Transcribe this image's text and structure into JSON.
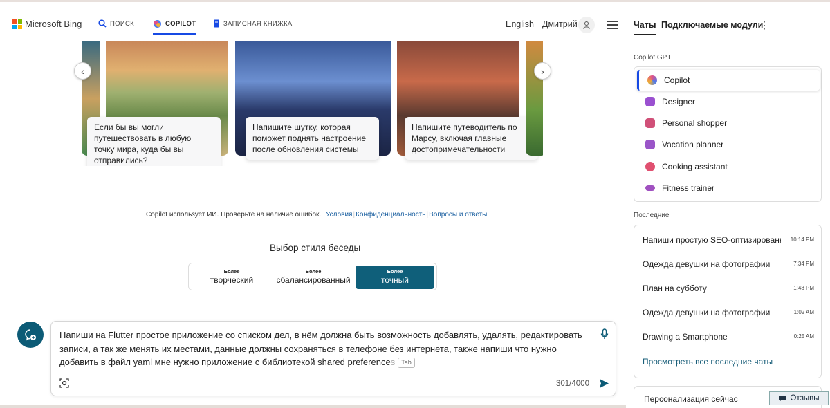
{
  "brand": "Microsoft Bing",
  "nav": {
    "search": "ПОИСК",
    "copilot": "COPILOT",
    "notebook": "ЗАПИСНАЯ КНИЖКА",
    "language": "English",
    "user": "Дмитрий"
  },
  "carousel": {
    "cards": [
      {
        "text": "Если бы вы могли путешествовать в любую точку мира, куда бы вы отправились?"
      },
      {
        "text": "Напишите шутку, которая поможет поднять настроение после обновления системы"
      },
      {
        "text": "Напишите путеводитель по Марсу, включая главные достопримечательности"
      }
    ]
  },
  "disclaimer": {
    "text": "Copilot использует ИИ. Проверьте на наличие ошибок.",
    "links": [
      "Условия",
      "Конфиденциальность",
      "Вопросы и ответы"
    ]
  },
  "conversation_style": {
    "title": "Выбор стиля беседы",
    "options": [
      {
        "small": "Более",
        "label": "творческий"
      },
      {
        "small": "Более",
        "label": "сбалансированный"
      },
      {
        "small": "Более",
        "label": "точный"
      }
    ],
    "selected": "точный"
  },
  "composer": {
    "value": "Напиши на Flutter простое приложение со списком дел, в нём должна быть возможность добавлять, удалять, редактировать записи, а так же менять их местами, данные должны сохраняться в телефоне без интернета, также напиши что нужно добавить в файл yaml мне нужно приложение с библиотекой shared preference",
    "suggestion_tail": "s",
    "tab_hint": "Tab",
    "counter": "301/4000"
  },
  "right_panel": {
    "tabs": [
      "Чаты",
      "Подключаемые модули"
    ],
    "gpt_label": "Copilot GPT",
    "gpts": [
      {
        "name": "Copilot",
        "icon": "copilot-icon",
        "color": "#e0508a"
      },
      {
        "name": "Designer",
        "icon": "designer-icon",
        "color": "#9a50d0"
      },
      {
        "name": "Personal shopper",
        "icon": "shopper-icon",
        "color": "#d05078"
      },
      {
        "name": "Vacation planner",
        "icon": "suitcase-icon",
        "color": "#9a55c8"
      },
      {
        "name": "Cooking assistant",
        "icon": "cooking-icon",
        "color": "#e05070"
      },
      {
        "name": "Fitness trainer",
        "icon": "dumbbell-icon",
        "color": "#a050c0"
      }
    ],
    "recent_label": "Последние",
    "recent": [
      {
        "title": "Напиши простую SEO-оптизированную",
        "time": "10:14 PM"
      },
      {
        "title": "Одежда девушки на фотографии",
        "time": "7:34 PM"
      },
      {
        "title": "План на субботу",
        "time": "1:48 PM"
      },
      {
        "title": "Одежда девушки на фотографии",
        "time": "1:02 AM"
      },
      {
        "title": "Drawing a Smartphone",
        "time": "0:25 AM"
      }
    ],
    "see_all": "Просмотреть все последние чаты",
    "personalization": "Персонализация сейчас",
    "feedback": "Отзывы"
  }
}
